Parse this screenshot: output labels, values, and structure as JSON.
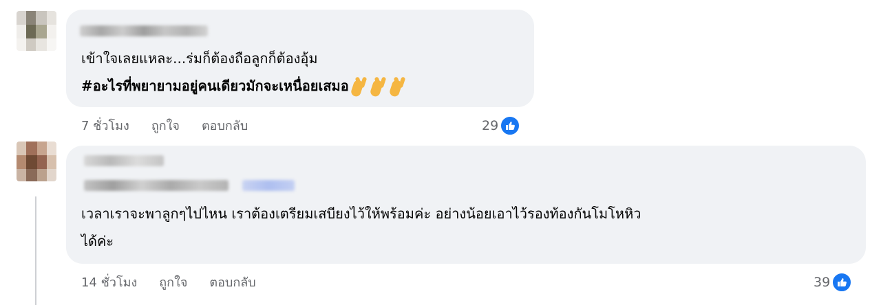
{
  "comments": [
    {
      "lines": [
        "เข้าใจเลยแหละ...ร่มก็ต้องถือลูกก็ต้องอุ้ม"
      ],
      "hashtag": "#อะไรที่พยายามอยู่คนเดียวมักจะเหนื่อยเสมอ",
      "emoji": [
        "victory-hand-icon",
        "victory-hand-icon",
        "victory-hand-icon"
      ],
      "time": "7 ชั่วโมง",
      "like_label": "ถูกใจ",
      "reply_label": "ตอบกลับ",
      "reaction_count": "29",
      "reaction_icon": "thumbs-up-icon"
    },
    {
      "lines": [
        "เวลาเราจะพาลูกๆไปไหน เราต้องเตรียมเสบียงไว้ให้พร้อมค่ะ อย่างน้อยเอาไว้รองท้องกันโมโหหิว",
        "ได้ค่ะ"
      ],
      "time": "14 ชั่วโมง",
      "like_label": "ถูกใจ",
      "reply_label": "ตอบกลับ",
      "reaction_count": "39",
      "reaction_icon": "thumbs-up-icon"
    }
  ],
  "colors": {
    "bubble": "#f0f2f5",
    "meta": "#65676b",
    "like_blue": "#1877f2"
  }
}
